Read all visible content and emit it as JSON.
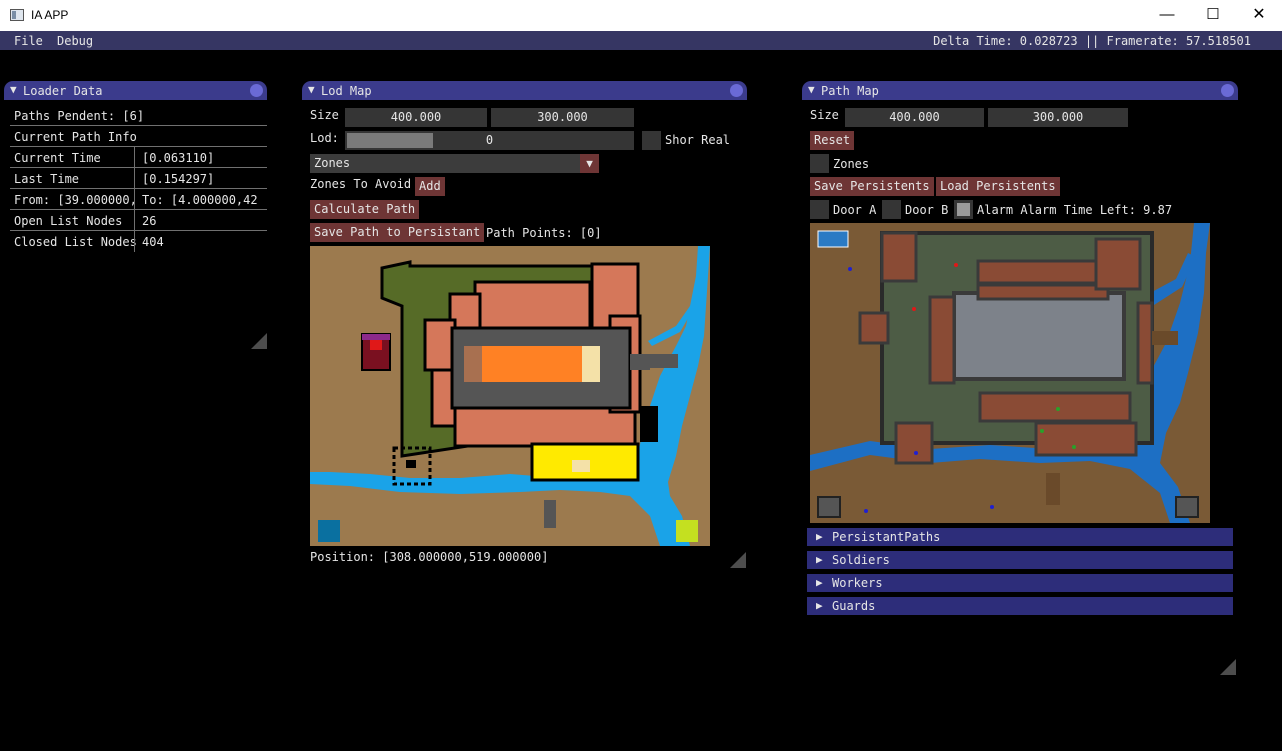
{
  "window": {
    "title": "IA APP",
    "minimize": "—",
    "maximize": "☐",
    "close": "✕"
  },
  "menubar": {
    "file": "File",
    "debug": "Debug",
    "stats": "Delta Time: 0.028723 || Framerate: 57.518501"
  },
  "loader": {
    "title": "Loader Data",
    "rows": [
      {
        "label": "Paths Pendent: [6]"
      },
      {
        "label": "Current Path Info"
      },
      {
        "label": "Current Time",
        "value": "[0.063110]"
      },
      {
        "label": "Last Time",
        "value": "[0.154297]"
      },
      {
        "label": "From: [39.000000,",
        "value": "To: [4.000000,42"
      },
      {
        "label": "Open List Nodes",
        "value": "26"
      },
      {
        "label": "Closed List Nodes",
        "value": "404"
      }
    ]
  },
  "lod": {
    "title": "Lod Map",
    "size_label": "Size",
    "size_w": "400.000",
    "size_h": "300.000",
    "lod_label": "Lod:",
    "lod_value": "0",
    "lod_fill": 0.3,
    "show_real_label": "Shor Real",
    "zones_combo": "Zones",
    "zones_avoid_label": "Zones To Avoid",
    "add_btn": "Add",
    "calc_btn": "Calculate Path",
    "save_btn": "Save Path to Persistant",
    "path_points": "Path Points: [0]",
    "position": "Position: [308.000000,519.000000]",
    "colors": {
      "ground": "#9c7a4e",
      "grass": "#566b27",
      "building": "#d5775a",
      "water": "#1aa3e8",
      "hall": "#555555",
      "orange": "#ff8124",
      "yellow": "#ffea00"
    }
  },
  "path": {
    "title": "Path Map",
    "size_label": "Size",
    "size_w": "400.000",
    "size_h": "300.000",
    "reset_btn": "Reset",
    "zones_label": "Zones",
    "save_persist_btn": "Save Persistents",
    "load_persist_btn": "Load Persistents",
    "door_a": "Door A",
    "door_b": "Door B",
    "alarm": "Alarm Alarm Time Left: 9.87",
    "sections": [
      "PersistantPaths",
      "Soldiers",
      "Workers",
      "Guards"
    ]
  }
}
